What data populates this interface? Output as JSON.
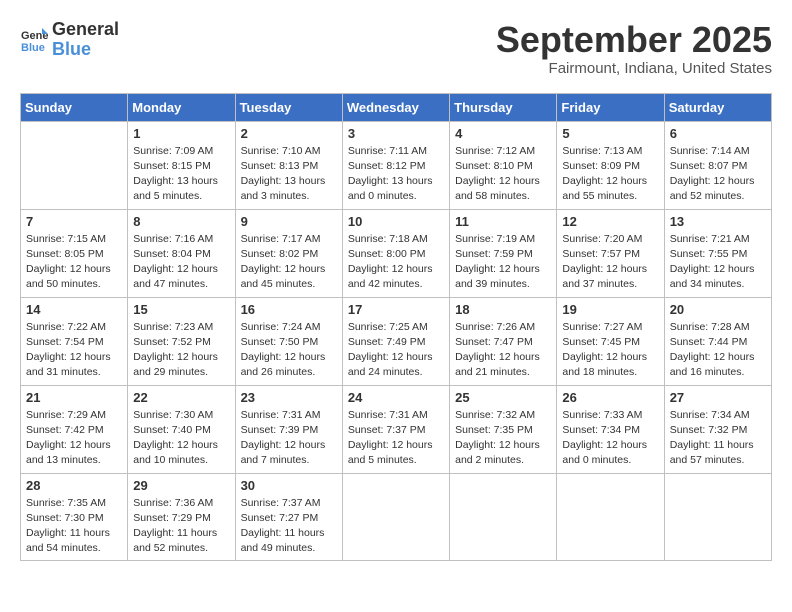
{
  "header": {
    "logo_general": "General",
    "logo_blue": "Blue",
    "month_title": "September 2025",
    "location": "Fairmount, Indiana, United States"
  },
  "weekdays": [
    "Sunday",
    "Monday",
    "Tuesday",
    "Wednesday",
    "Thursday",
    "Friday",
    "Saturday"
  ],
  "weeks": [
    [
      {
        "day": "",
        "info": ""
      },
      {
        "day": "1",
        "info": "Sunrise: 7:09 AM\nSunset: 8:15 PM\nDaylight: 13 hours\nand 5 minutes."
      },
      {
        "day": "2",
        "info": "Sunrise: 7:10 AM\nSunset: 8:13 PM\nDaylight: 13 hours\nand 3 minutes."
      },
      {
        "day": "3",
        "info": "Sunrise: 7:11 AM\nSunset: 8:12 PM\nDaylight: 13 hours\nand 0 minutes."
      },
      {
        "day": "4",
        "info": "Sunrise: 7:12 AM\nSunset: 8:10 PM\nDaylight: 12 hours\nand 58 minutes."
      },
      {
        "day": "5",
        "info": "Sunrise: 7:13 AM\nSunset: 8:09 PM\nDaylight: 12 hours\nand 55 minutes."
      },
      {
        "day": "6",
        "info": "Sunrise: 7:14 AM\nSunset: 8:07 PM\nDaylight: 12 hours\nand 52 minutes."
      }
    ],
    [
      {
        "day": "7",
        "info": "Sunrise: 7:15 AM\nSunset: 8:05 PM\nDaylight: 12 hours\nand 50 minutes."
      },
      {
        "day": "8",
        "info": "Sunrise: 7:16 AM\nSunset: 8:04 PM\nDaylight: 12 hours\nand 47 minutes."
      },
      {
        "day": "9",
        "info": "Sunrise: 7:17 AM\nSunset: 8:02 PM\nDaylight: 12 hours\nand 45 minutes."
      },
      {
        "day": "10",
        "info": "Sunrise: 7:18 AM\nSunset: 8:00 PM\nDaylight: 12 hours\nand 42 minutes."
      },
      {
        "day": "11",
        "info": "Sunrise: 7:19 AM\nSunset: 7:59 PM\nDaylight: 12 hours\nand 39 minutes."
      },
      {
        "day": "12",
        "info": "Sunrise: 7:20 AM\nSunset: 7:57 PM\nDaylight: 12 hours\nand 37 minutes."
      },
      {
        "day": "13",
        "info": "Sunrise: 7:21 AM\nSunset: 7:55 PM\nDaylight: 12 hours\nand 34 minutes."
      }
    ],
    [
      {
        "day": "14",
        "info": "Sunrise: 7:22 AM\nSunset: 7:54 PM\nDaylight: 12 hours\nand 31 minutes."
      },
      {
        "day": "15",
        "info": "Sunrise: 7:23 AM\nSunset: 7:52 PM\nDaylight: 12 hours\nand 29 minutes."
      },
      {
        "day": "16",
        "info": "Sunrise: 7:24 AM\nSunset: 7:50 PM\nDaylight: 12 hours\nand 26 minutes."
      },
      {
        "day": "17",
        "info": "Sunrise: 7:25 AM\nSunset: 7:49 PM\nDaylight: 12 hours\nand 24 minutes."
      },
      {
        "day": "18",
        "info": "Sunrise: 7:26 AM\nSunset: 7:47 PM\nDaylight: 12 hours\nand 21 minutes."
      },
      {
        "day": "19",
        "info": "Sunrise: 7:27 AM\nSunset: 7:45 PM\nDaylight: 12 hours\nand 18 minutes."
      },
      {
        "day": "20",
        "info": "Sunrise: 7:28 AM\nSunset: 7:44 PM\nDaylight: 12 hours\nand 16 minutes."
      }
    ],
    [
      {
        "day": "21",
        "info": "Sunrise: 7:29 AM\nSunset: 7:42 PM\nDaylight: 12 hours\nand 13 minutes."
      },
      {
        "day": "22",
        "info": "Sunrise: 7:30 AM\nSunset: 7:40 PM\nDaylight: 12 hours\nand 10 minutes."
      },
      {
        "day": "23",
        "info": "Sunrise: 7:31 AM\nSunset: 7:39 PM\nDaylight: 12 hours\nand 7 minutes."
      },
      {
        "day": "24",
        "info": "Sunrise: 7:31 AM\nSunset: 7:37 PM\nDaylight: 12 hours\nand 5 minutes."
      },
      {
        "day": "25",
        "info": "Sunrise: 7:32 AM\nSunset: 7:35 PM\nDaylight: 12 hours\nand 2 minutes."
      },
      {
        "day": "26",
        "info": "Sunrise: 7:33 AM\nSunset: 7:34 PM\nDaylight: 12 hours\nand 0 minutes."
      },
      {
        "day": "27",
        "info": "Sunrise: 7:34 AM\nSunset: 7:32 PM\nDaylight: 11 hours\nand 57 minutes."
      }
    ],
    [
      {
        "day": "28",
        "info": "Sunrise: 7:35 AM\nSunset: 7:30 PM\nDaylight: 11 hours\nand 54 minutes."
      },
      {
        "day": "29",
        "info": "Sunrise: 7:36 AM\nSunset: 7:29 PM\nDaylight: 11 hours\nand 52 minutes."
      },
      {
        "day": "30",
        "info": "Sunrise: 7:37 AM\nSunset: 7:27 PM\nDaylight: 11 hours\nand 49 minutes."
      },
      {
        "day": "",
        "info": ""
      },
      {
        "day": "",
        "info": ""
      },
      {
        "day": "",
        "info": ""
      },
      {
        "day": "",
        "info": ""
      }
    ]
  ]
}
